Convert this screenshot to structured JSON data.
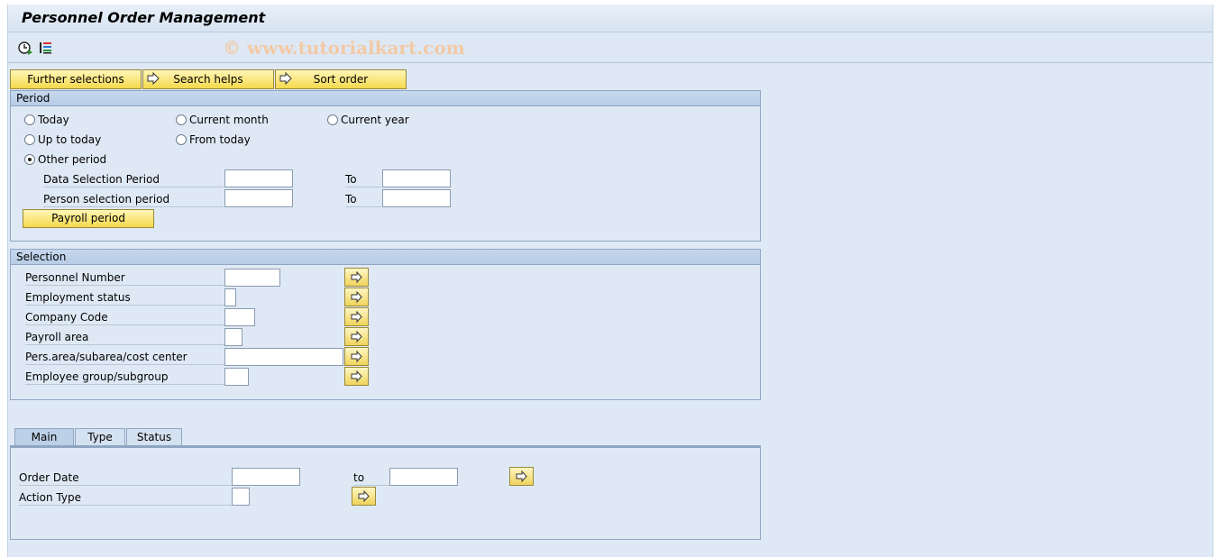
{
  "window": {
    "title": "Personnel Order Management"
  },
  "toolbar": {
    "icons": [
      "clock-execute-icon",
      "selection-variants-icon"
    ],
    "watermark": "© www.tutorialkart.com"
  },
  "buttons": {
    "further_selections": "Further selections",
    "search_helps": "Search helps",
    "sort_order": "Sort order"
  },
  "period": {
    "title": "Period",
    "radios": {
      "today": "Today",
      "current_month": "Current month",
      "current_year": "Current year",
      "up_to_today": "Up to today",
      "from_today": "From today",
      "other_period": "Other period"
    },
    "selected": "other_period",
    "data_selection_label": "Data Selection Period",
    "person_selection_label": "Person selection period",
    "to_label": "To",
    "data_from": "",
    "data_to": "",
    "person_from": "",
    "person_to": "",
    "payroll_button": "Payroll period"
  },
  "selection": {
    "title": "Selection",
    "fields": [
      {
        "label": "Personnel Number",
        "value": ""
      },
      {
        "label": "Employment status",
        "value": ""
      },
      {
        "label": "Company Code",
        "value": ""
      },
      {
        "label": "Payroll area",
        "value": ""
      },
      {
        "label": "Pers.area/subarea/cost center",
        "value": ""
      },
      {
        "label": "Employee group/subgroup",
        "value": ""
      }
    ]
  },
  "tabs": {
    "items": [
      "Main",
      "Type",
      "Status"
    ],
    "active": "Main"
  },
  "main_tab": {
    "order_date_label": "Order Date",
    "to_label": "to",
    "action_type_label": "Action Type",
    "order_date_from": "",
    "order_date_to": "",
    "action_type": ""
  }
}
